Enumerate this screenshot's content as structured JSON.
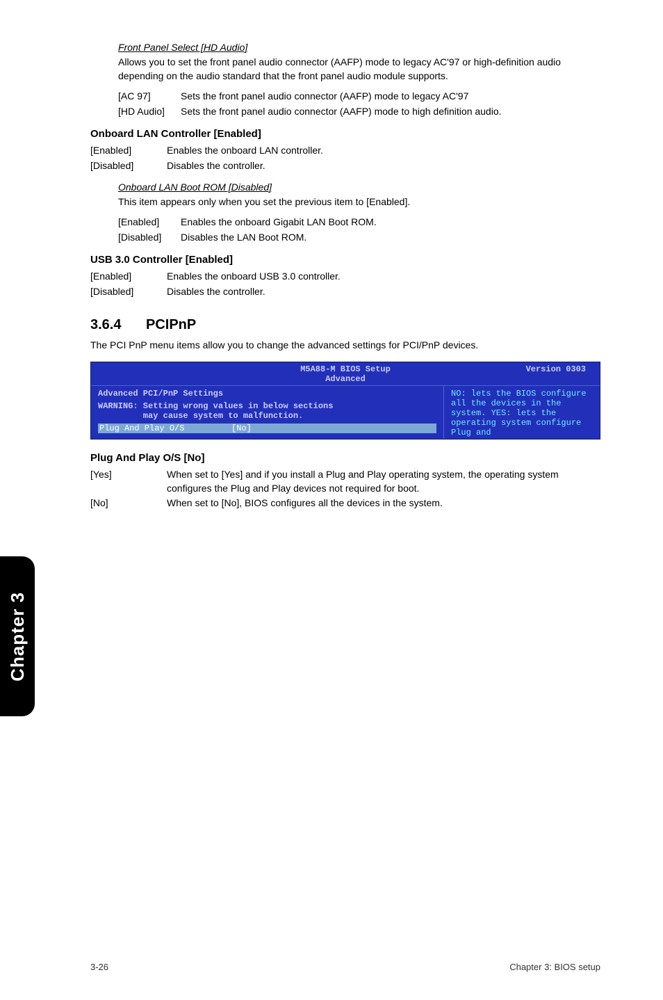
{
  "s1": {
    "heading": "Front Panel Select [HD Audio]",
    "desc": "Allows you to set the front panel audio connector (AAFP) mode to legacy AC'97 or high-definition audio depending on the audio standard that the front panel audio module supports.",
    "row1k": "[AC 97]",
    "row1v": "Sets the front panel audio connector (AAFP) mode to legacy AC'97",
    "row2k": "[HD Audio]",
    "row2v": "Sets the front panel audio connector (AAFP) mode to high definition audio."
  },
  "s2": {
    "heading": "Onboard LAN Controller [Enabled]",
    "row1k": "[Enabled]",
    "row1v": "Enables the onboard LAN controller.",
    "row2k": "[Disabled]",
    "row2v": "Disables the controller."
  },
  "s3": {
    "heading": "Onboard LAN Boot ROM [Disabled]",
    "desc": "This item appears only when you set the previous item to [Enabled].",
    "row1k": "[Enabled]",
    "row1v": "Enables the onboard Gigabit LAN Boot ROM.",
    "row2k": "[Disabled]",
    "row2v": "Disables the LAN Boot ROM."
  },
  "s4": {
    "heading": "USB 3.0 Controller [Enabled]",
    "row1k": "[Enabled]",
    "row1v": "Enables the onboard USB 3.0 controller.",
    "row2k": "[Disabled]",
    "row2v": "Disables the controller."
  },
  "sec": {
    "num": "3.6.4",
    "title": "PCIPnP",
    "desc": "The PCI PnP menu items allow you to change the advanced settings for PCI/PnP devices."
  },
  "bios": {
    "title": "M5A88-M BIOS Setup",
    "version": "Version 0303",
    "tab": "Advanced",
    "l1": "Advanced PCI/PnP Settings",
    "l2": "WARNING: Setting wrong values in below sections",
    "l3": "         may cause system to malfunction.",
    "sel_key": "Plug And Play O/S",
    "sel_val": "[No]",
    "help": "NO: lets the BIOS configure all the devices in the system. YES: lets the operating system configure Plug and"
  },
  "s5": {
    "heading": "Plug And Play O/S [No]",
    "row1k": "[Yes]",
    "row1v": "When set to [Yes] and if you install a Plug and Play operating system, the operating system configures the Plug and Play devices not required for boot.",
    "row2k": "[No]",
    "row2v": "When set to [No], BIOS configures all the devices in the system."
  },
  "sidetab": "Chapter 3",
  "footer": {
    "left": "3-26",
    "right": "Chapter 3: BIOS setup"
  }
}
